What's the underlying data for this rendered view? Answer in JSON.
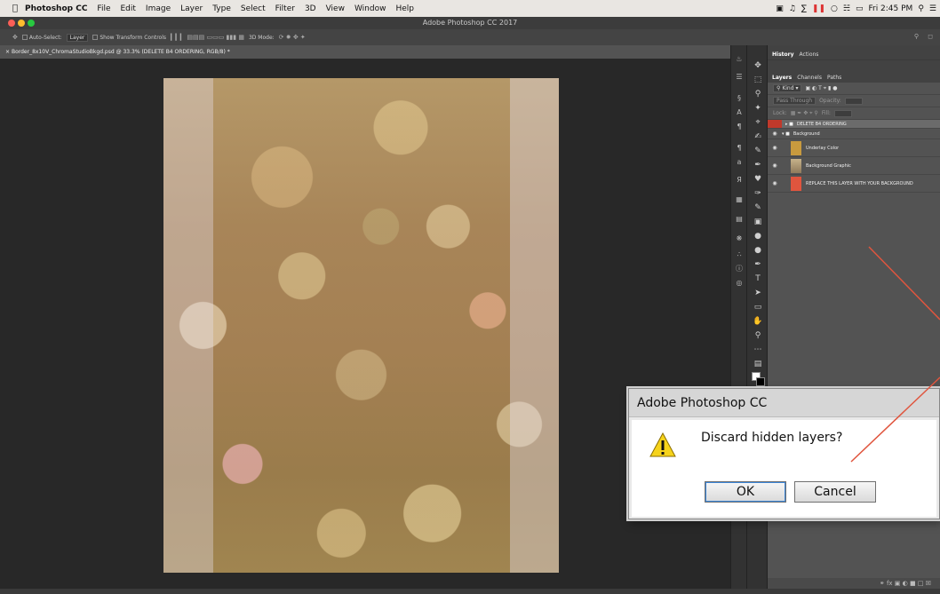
{
  "macbar": {
    "apple": "",
    "app": "Photoshop CC",
    "menus": [
      "File",
      "Edit",
      "Image",
      "Layer",
      "Type",
      "Select",
      "Filter",
      "3D",
      "View",
      "Window",
      "Help"
    ],
    "clock": "Fri 2:45 PM"
  },
  "window": {
    "title": "Adobe Photoshop CC 2017"
  },
  "options": {
    "auto_select": "Auto-Select:",
    "auto_select_value": "Layer",
    "show_transform": "Show Transform Controls",
    "mode_3d": "3D Mode:"
  },
  "document": {
    "tab_title": "Border_8x10V_ChromaStudioBkgd.psd @ 33.3% (DELETE B4 ORDERING, RGB/8) *"
  },
  "panel": {
    "top_tabs": [
      "History",
      "Actions"
    ],
    "layer_tabs": [
      "Layers",
      "Channels",
      "Paths"
    ],
    "kind": "Kind",
    "blend_mode": "Pass Through",
    "opacity_label": "Opacity:",
    "lock_label": "Lock:",
    "fill_label": "Fill:",
    "layers": [
      {
        "name": "DELETE B4 ORDERING",
        "type": "group",
        "selected": true,
        "visible": false
      },
      {
        "name": "Background",
        "type": "group",
        "selected": false,
        "visible": true
      },
      {
        "name": "Underlay Color",
        "type": "layer",
        "selected": false,
        "visible": true
      },
      {
        "name": "Background Graphic",
        "type": "layer",
        "selected": false,
        "visible": true
      },
      {
        "name": "REPLACE THIS LAYER WITH YOUR BACKGROUND",
        "type": "layer",
        "selected": false,
        "visible": true
      }
    ]
  },
  "dialog": {
    "title": "Adobe Photoshop CC",
    "message": "Discard hidden layers?",
    "ok": "OK",
    "cancel": "Cancel"
  },
  "colors": {
    "annotation_arrow": "#e0553e",
    "selection": "#6b6b6b",
    "swatch_red": "#e0553e"
  }
}
